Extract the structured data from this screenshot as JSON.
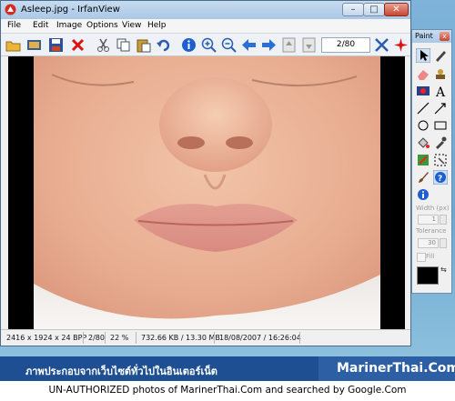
{
  "window": {
    "title": "Asleep.jpg - IrfanView",
    "controls": {
      "minimize": "–",
      "maximize": "□",
      "close": "✕"
    }
  },
  "menu": [
    "File",
    "Edit",
    "Image",
    "Options",
    "View",
    "Help"
  ],
  "toolbar": {
    "buttons": [
      "open-folder",
      "slideshow",
      "save",
      "delete",
      "cut",
      "copy",
      "paste",
      "undo",
      "info",
      "zoom-in",
      "zoom-out",
      "previous",
      "next",
      "first-page",
      "last-page",
      "properties",
      "exit"
    ],
    "page_indicator": "2/80"
  },
  "status": {
    "dimensions": "2416 x 1924 x 24 BPP",
    "page": "2/80",
    "zoom": "22 %",
    "filesize": "732.66 KB / 13.30 MB",
    "datetime": "18/08/2007 / 16:26:04"
  },
  "paint": {
    "title": "Paint",
    "close": "x",
    "width_label": "Width (px)",
    "width_value": "1",
    "tolerance_label": "Tolerance",
    "tolerance_value": "30",
    "fill_label": "Fill"
  },
  "banner": {
    "thai_text": "ภาพประกอบจากเว็บไซต์ทั่วไปในอินเตอร์เน็ต",
    "brand": "MarinerThai.Com"
  },
  "footer": "UN-AUTHORIZED photos of MarinerThai.Com and searched by Google.Com",
  "colors": {
    "banner": "#1f4f93",
    "titlebar": "#a9c8e6",
    "close": "#c8452f"
  }
}
